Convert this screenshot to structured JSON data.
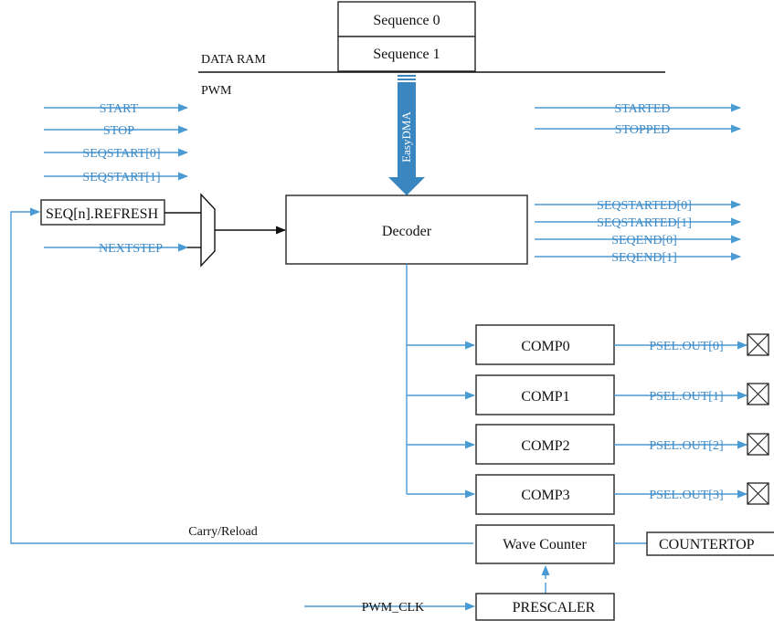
{
  "colors": {
    "signal_blue": "#4a9ad4",
    "label_blue": "#3d8ac6",
    "dma_arrow": "#3a86c0",
    "box_stroke": "#333333"
  },
  "memory": {
    "region_label": "DATA RAM",
    "sequences": [
      "Sequence 0",
      "Sequence 1"
    ]
  },
  "peripheral_label": "PWM",
  "dma_label": "EasyDMA",
  "tasks": [
    "START",
    "STOP",
    "SEQSTART[0]",
    "SEQSTART[1]"
  ],
  "refresh_box": "SEQ[n].REFRESH",
  "nextstep": "NEXTSTEP",
  "decoder": "Decoder",
  "events_top": [
    "STARTED",
    "STOPPED"
  ],
  "events_decoder": [
    "SEQSTARTED[0]",
    "SEQSTARTED[1]",
    "SEQEND[0]",
    "SEQEND[1]"
  ],
  "comparators": [
    {
      "name": "COMP0",
      "output": "PSEL.OUT[0]"
    },
    {
      "name": "COMP1",
      "output": "PSEL.OUT[1]"
    },
    {
      "name": "COMP2",
      "output": "PSEL.OUT[2]"
    },
    {
      "name": "COMP3",
      "output": "PSEL.OUT[3]"
    }
  ],
  "carry_reload": "Carry/Reload",
  "wave_counter": "Wave Counter",
  "countertop": "COUNTERTOP",
  "prescaler": "PRESCALER",
  "clock": "PWM_CLK"
}
